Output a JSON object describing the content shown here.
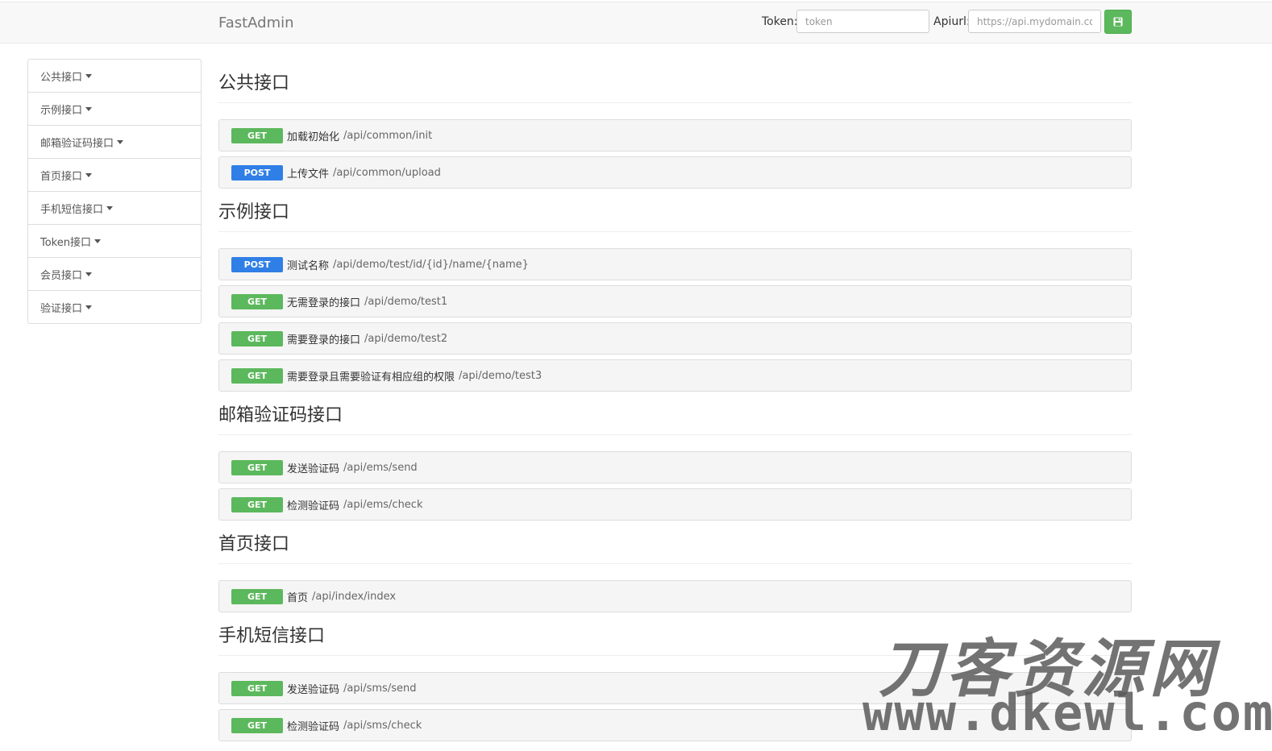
{
  "header": {
    "brand": "FastAdmin",
    "token_label": "Token:",
    "token_placeholder": "token",
    "apiurl_label": "Apiurl:",
    "apiurl_placeholder": "https://api.mydomain.com",
    "save_icon": "save-icon"
  },
  "sidebar": {
    "items": [
      {
        "label": "公共接口"
      },
      {
        "label": "示例接口"
      },
      {
        "label": "邮箱验证码接口"
      },
      {
        "label": "首页接口"
      },
      {
        "label": "手机短信接口"
      },
      {
        "label": "Token接口"
      },
      {
        "label": "会员接口"
      },
      {
        "label": "验证接口"
      }
    ]
  },
  "sections": [
    {
      "title": "公共接口",
      "apis": [
        {
          "method": "GET",
          "title": "加载初始化",
          "path": "/api/common/init"
        },
        {
          "method": "POST",
          "title": "上传文件",
          "path": "/api/common/upload"
        }
      ]
    },
    {
      "title": "示例接口",
      "apis": [
        {
          "method": "POST",
          "title": "测试名称",
          "path": "/api/demo/test/id/{id}/name/{name}"
        },
        {
          "method": "GET",
          "title": "无需登录的接口",
          "path": "/api/demo/test1"
        },
        {
          "method": "GET",
          "title": "需要登录的接口",
          "path": "/api/demo/test2"
        },
        {
          "method": "GET",
          "title": "需要登录且需要验证有相应组的权限",
          "path": "/api/demo/test3"
        }
      ]
    },
    {
      "title": "邮箱验证码接口",
      "apis": [
        {
          "method": "GET",
          "title": "发送验证码",
          "path": "/api/ems/send"
        },
        {
          "method": "GET",
          "title": "检测验证码",
          "path": "/api/ems/check"
        }
      ]
    },
    {
      "title": "首页接口",
      "apis": [
        {
          "method": "GET",
          "title": "首页",
          "path": "/api/index/index"
        }
      ]
    },
    {
      "title": "手机短信接口",
      "apis": [
        {
          "method": "GET",
          "title": "发送验证码",
          "path": "/api/sms/send"
        },
        {
          "method": "GET",
          "title": "检测验证码",
          "path": "/api/sms/check"
        }
      ]
    }
  ],
  "watermark": {
    "text_cn": "刀客资源网",
    "text_url": "www.dkewl.com"
  },
  "colors": {
    "get": "#5cb85c",
    "post": "#2f7fe6",
    "save_button": "#5cb85c"
  }
}
